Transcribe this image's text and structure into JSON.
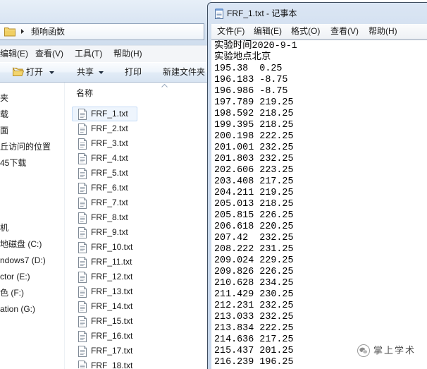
{
  "explorer": {
    "address": {
      "icon": "folder-icon",
      "separator_icon": "chevron-right-icon",
      "breadcrumb": "频响函数"
    },
    "menu": [
      "编辑(E)",
      "查看(V)",
      "工具(T)",
      "帮助(H)"
    ],
    "toolbar": {
      "open": {
        "label": "打开",
        "icon": "open-folder-icon",
        "dropdown_icon": "chevron-down-icon"
      },
      "share": {
        "label": "共享",
        "dropdown_icon": "chevron-down-icon"
      },
      "print": {
        "label": "打印"
      },
      "new_folder": {
        "label": "新建文件夹"
      }
    },
    "nav_pane": {
      "favorites": [
        "夹",
        "载",
        "面",
        "丘访问的位置",
        "45下载"
      ],
      "computer": [
        "机",
        "地磁盘 (C:)",
        "ndows7 (D:)",
        "ctor (E:)",
        "色 (F:)",
        "ation (G:)"
      ]
    },
    "file_list": {
      "column_name": "名称",
      "sort_icon": "sort-ascending-icon",
      "file_icon": "text-file-icon",
      "files": [
        {
          "name": "FRF_1.txt",
          "selected": true
        },
        {
          "name": "FRF_2.txt"
        },
        {
          "name": "FRF_3.txt"
        },
        {
          "name": "FRF_4.txt"
        },
        {
          "name": "FRF_5.txt"
        },
        {
          "name": "FRF_6.txt"
        },
        {
          "name": "FRF_7.txt"
        },
        {
          "name": "FRF_8.txt"
        },
        {
          "name": "FRF_9.txt"
        },
        {
          "name": "FRF_10.txt"
        },
        {
          "name": "FRF_11.txt"
        },
        {
          "name": "FRF_12.txt"
        },
        {
          "name": "FRF_13.txt"
        },
        {
          "name": "FRF_14.txt"
        },
        {
          "name": "FRF_15.txt"
        },
        {
          "name": "FRF_16.txt"
        },
        {
          "name": "FRF_17.txt"
        },
        {
          "name": "FRF_18.txt"
        }
      ]
    }
  },
  "notepad": {
    "icon": "notepad-icon",
    "title": "FRF_1.txt - 记事本",
    "menu": [
      "文件(F)",
      "编辑(E)",
      "格式(O)",
      "查看(V)",
      "帮助(H)"
    ],
    "lines": [
      "实验时间2020-9-1",
      "实验地点北京",
      "195.38  0.25",
      "196.183 -8.75",
      "196.986 -8.75",
      "197.789 219.25",
      "198.592 218.25",
      "199.395 218.25",
      "200.198 222.25",
      "201.001 232.25",
      "201.803 232.25",
      "202.606 223.25",
      "203.408 217.25",
      "204.211 219.25",
      "205.013 218.25",
      "205.815 226.25",
      "206.618 220.25",
      "207.42  232.25",
      "208.222 231.25",
      "209.024 229.25",
      "209.826 226.25",
      "210.628 234.25",
      "211.429 230.25",
      "212.231 232.25",
      "213.033 232.25",
      "213.834 222.25",
      "214.636 217.25",
      "215.437 201.25",
      "216.239 196.25"
    ]
  },
  "watermark": {
    "icon": "wechat-icon",
    "text": "掌上学术"
  },
  "colors": {
    "selection_fill": "#eef5fd",
    "selection_border": "#c5dcf6",
    "watermark_text": "#4d4d4d"
  }
}
